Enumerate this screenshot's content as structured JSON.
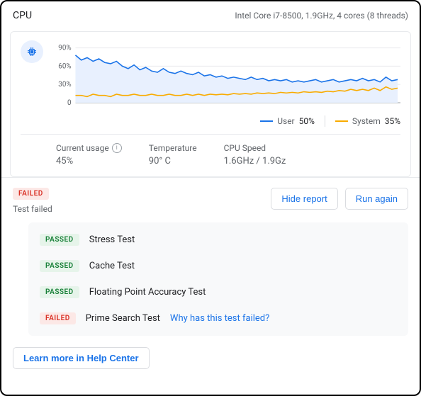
{
  "header": {
    "title": "CPU",
    "subtitle": "Intel Core i7-8500, 1.9GHz, 4 cores (8 threads)"
  },
  "chart_data": {
    "type": "line",
    "yticks": [
      "90%",
      "60%",
      "30%",
      "0"
    ],
    "ylim": [
      0,
      100
    ],
    "series": [
      {
        "name": "User",
        "color": "#1a73e8",
        "values": [
          78,
          70,
          74,
          68,
          72,
          66,
          64,
          68,
          60,
          56,
          62,
          54,
          58,
          52,
          50,
          56,
          50,
          48,
          52,
          48,
          46,
          50,
          44,
          46,
          42,
          44,
          40,
          42,
          40,
          38,
          42,
          38,
          40,
          36,
          38,
          36,
          38,
          34,
          36,
          34,
          36,
          38,
          34,
          36,
          38,
          34,
          36,
          38,
          36,
          40,
          36,
          38,
          34,
          42,
          36,
          38
        ]
      },
      {
        "name": "System",
        "color": "#f9ab00",
        "values": [
          12,
          12,
          10,
          14,
          12,
          12,
          10,
          14,
          12,
          12,
          14,
          12,
          12,
          14,
          12,
          12,
          14,
          12,
          12,
          14,
          12,
          14,
          12,
          14,
          13,
          14,
          13,
          15,
          14,
          15,
          14,
          16,
          15,
          16,
          15,
          17,
          16,
          17,
          16,
          18,
          17,
          18,
          17,
          19,
          18,
          20,
          19,
          22,
          20,
          22,
          20,
          24,
          20,
          26,
          22,
          24
        ]
      }
    ]
  },
  "legend": {
    "user_label": "User",
    "user_value": "50%",
    "system_label": "System",
    "system_value": "35%"
  },
  "stats": {
    "usage_label": "Current usage",
    "usage_value": "45%",
    "temp_label": "Temperature",
    "temp_value": "90° C",
    "speed_label": "CPU Speed",
    "speed_value": "1.6GHz / 1.9Gz"
  },
  "status": {
    "badge": "FAILED",
    "message": "Test failed",
    "hide_btn": "Hide report",
    "run_btn": "Run again"
  },
  "tests": [
    {
      "status": "PASSED",
      "name": "Stress Test"
    },
    {
      "status": "PASSED",
      "name": "Cache Test"
    },
    {
      "status": "PASSED",
      "name": "Floating Point Accuracy Test"
    },
    {
      "status": "FAILED",
      "name": "Prime Search Test",
      "link": "Why has this test failed?"
    }
  ],
  "footer": {
    "learn_more": "Learn more in Help Center"
  }
}
